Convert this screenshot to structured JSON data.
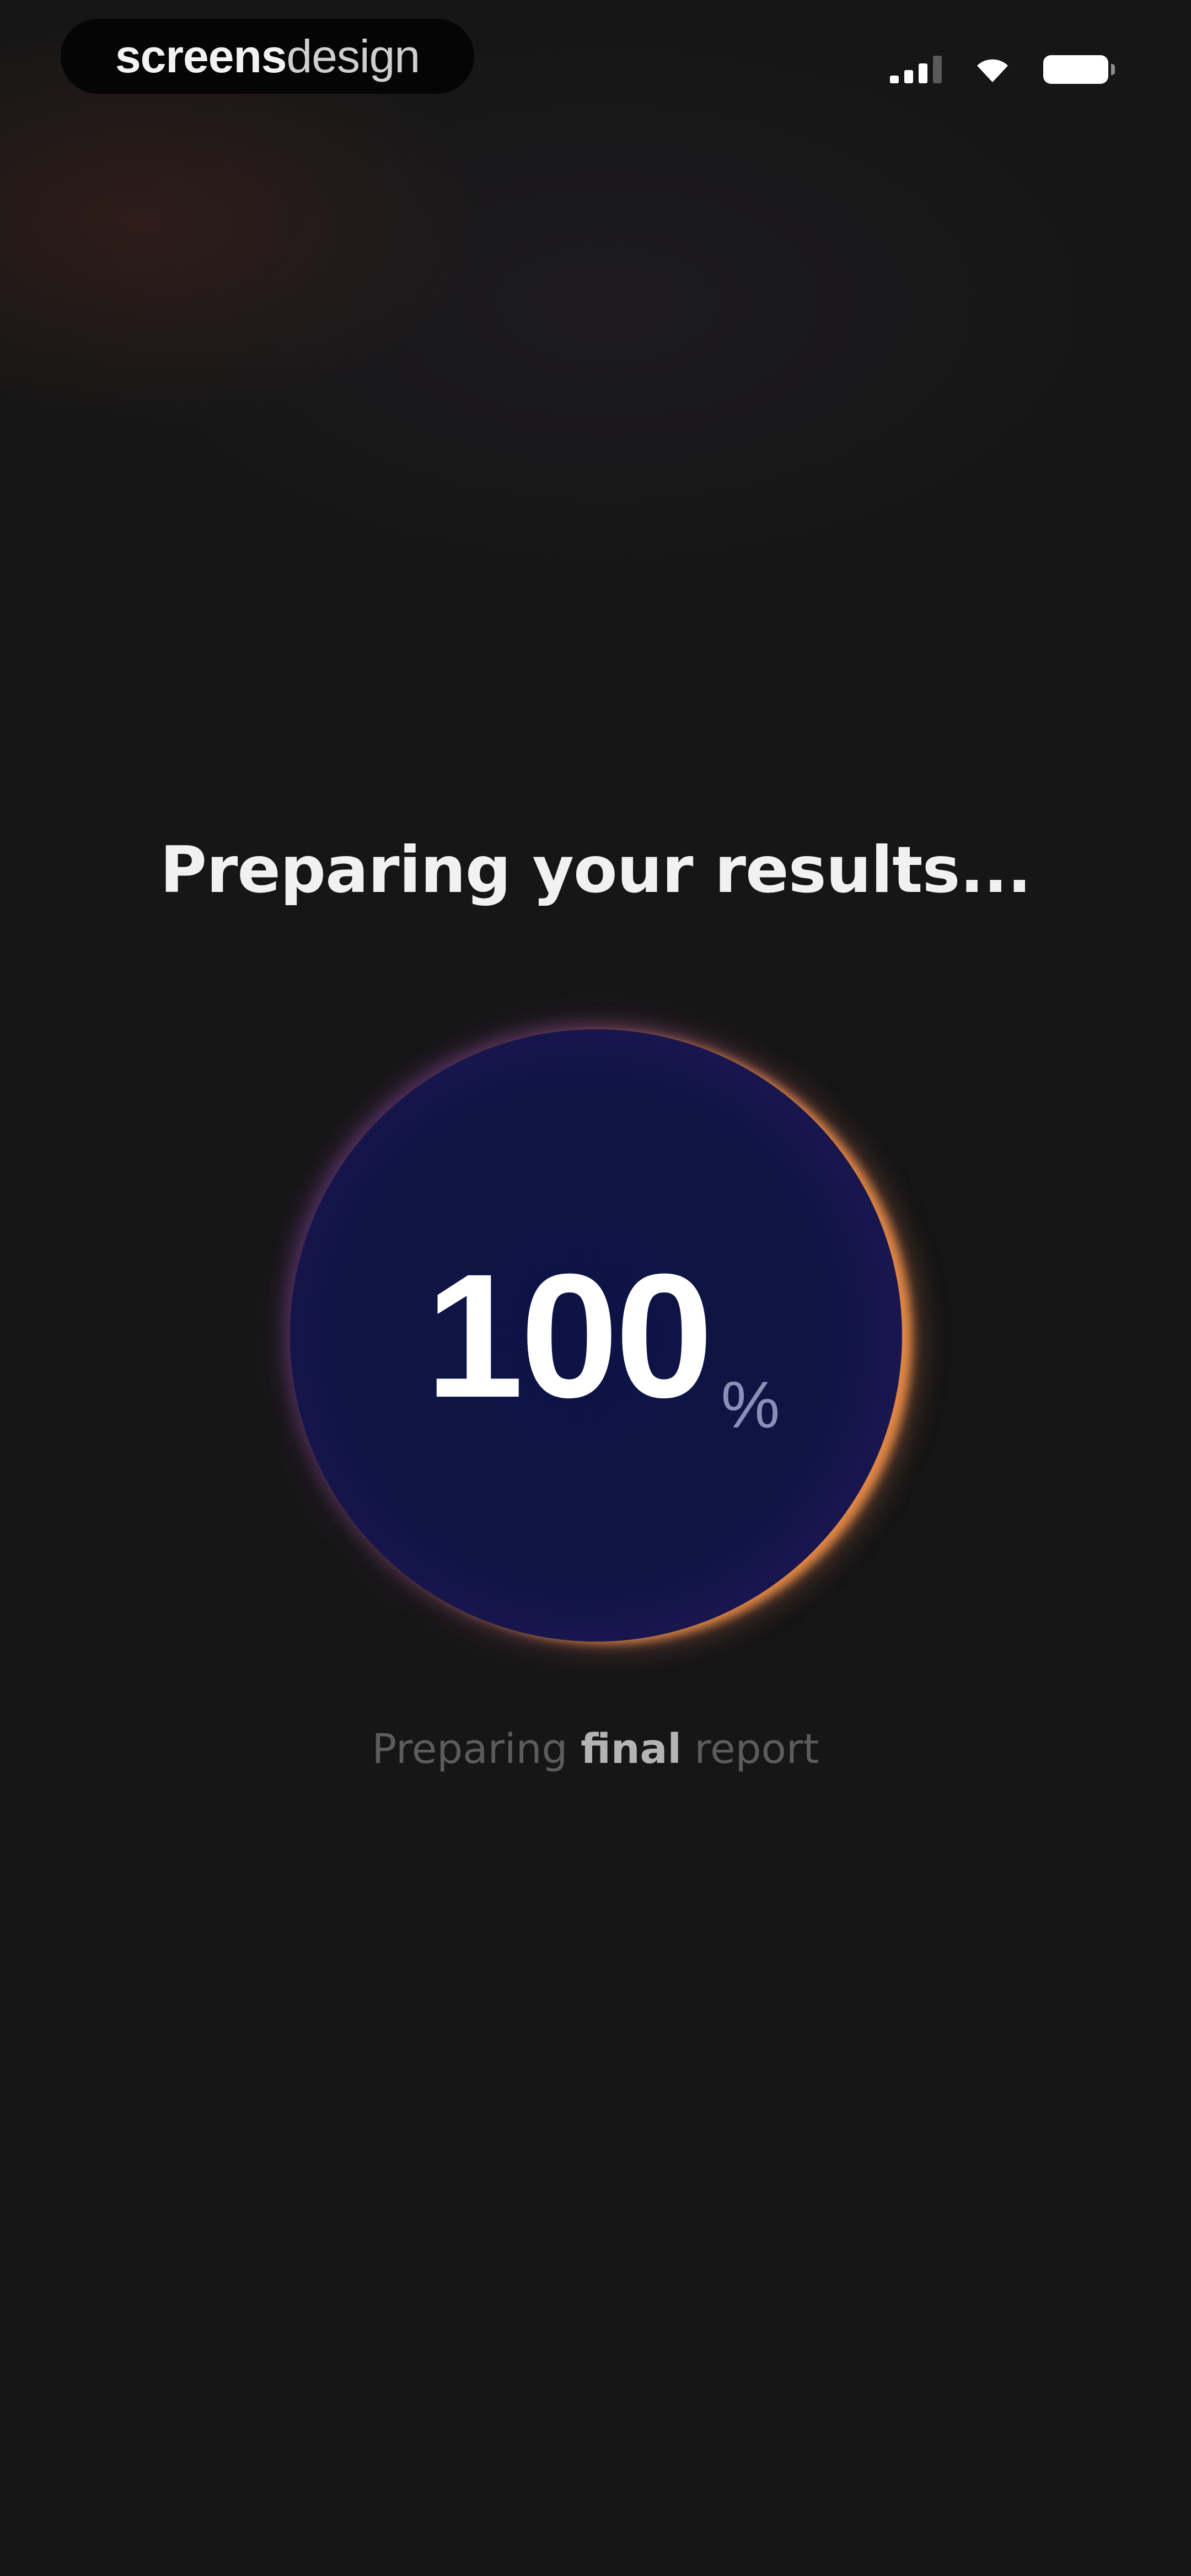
{
  "status_bar": {
    "brand_strong": "screens",
    "brand_light": "design",
    "signal_icon": "cellular-signal-icon",
    "wifi_icon": "wifi-icon",
    "battery_icon": "battery-icon"
  },
  "main": {
    "headline": "Preparing your results...",
    "progress": {
      "value": "100",
      "unit": "%"
    },
    "status": {
      "before": "Preparing",
      "emphasis": "final",
      "after": "report"
    }
  },
  "colors": {
    "background": "#161616",
    "orb_fill": "#0e1444",
    "orb_rim_warm": "#e88c46",
    "orb_rim_cool": "#8246aa",
    "muted_text": "#5c5c5c"
  }
}
